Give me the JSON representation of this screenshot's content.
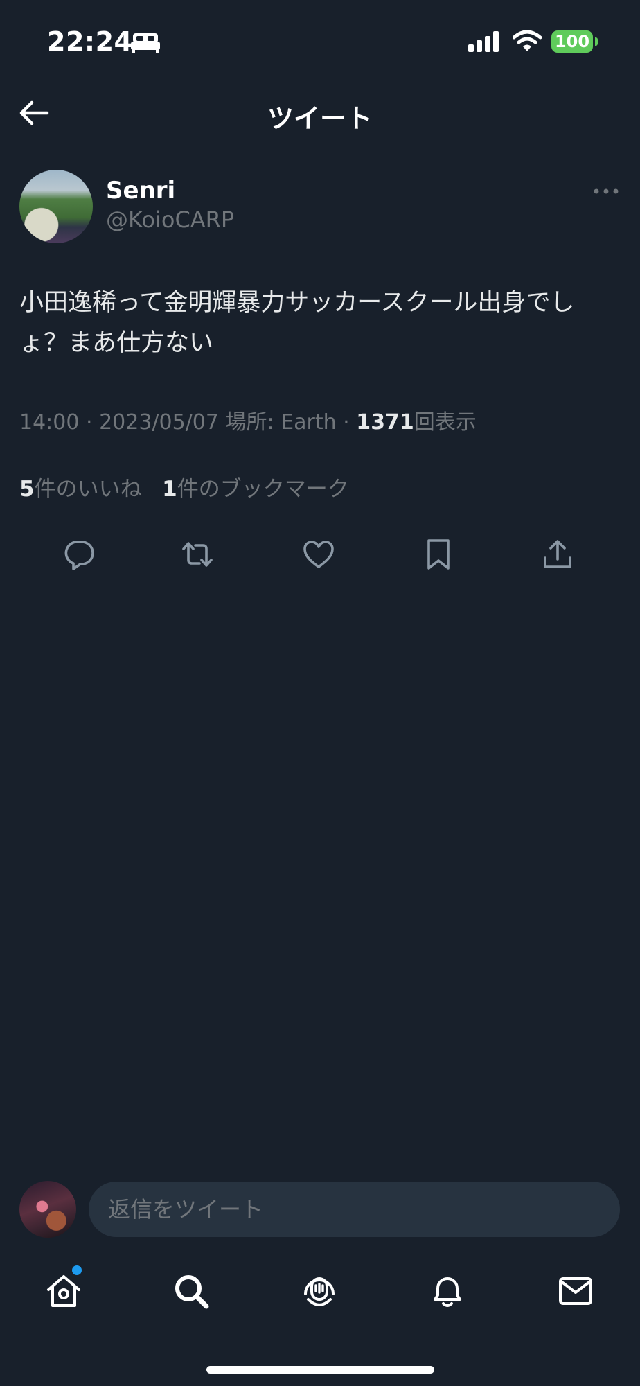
{
  "status_bar": {
    "time": "22:24",
    "battery": "100",
    "icons": [
      "bed-icon",
      "signal-icon",
      "wifi-icon",
      "battery-icon"
    ]
  },
  "header": {
    "title": "ツイート",
    "back_icon": "arrow-left-icon"
  },
  "tweet": {
    "author_name": "Senri",
    "author_handle": "@KoioCARP",
    "text": "小田逸稀って金明輝暴力サッカースクール出身でしょ？まあ仕方ない",
    "meta_prefix": "14:00 · 2023/05/07 場所: Earth · ",
    "views_count": "1371",
    "views_label": "回表示",
    "likes_count": "5",
    "likes_label": "件のいいね",
    "bookmarks_count": "1",
    "bookmarks_label": "件のブックマーク"
  },
  "actions": [
    "reply-icon",
    "retweet-icon",
    "like-icon",
    "bookmark-icon",
    "share-icon"
  ],
  "reply_bar": {
    "placeholder": "返信をツイート"
  },
  "tab_bar": [
    "home-icon",
    "search-icon",
    "spaces-icon",
    "notifications-icon",
    "messages-icon"
  ],
  "colors": {
    "background": "#18202b",
    "muted": "#71767b",
    "accent": "#1d9bf0",
    "battery": "#5fcb5b"
  }
}
